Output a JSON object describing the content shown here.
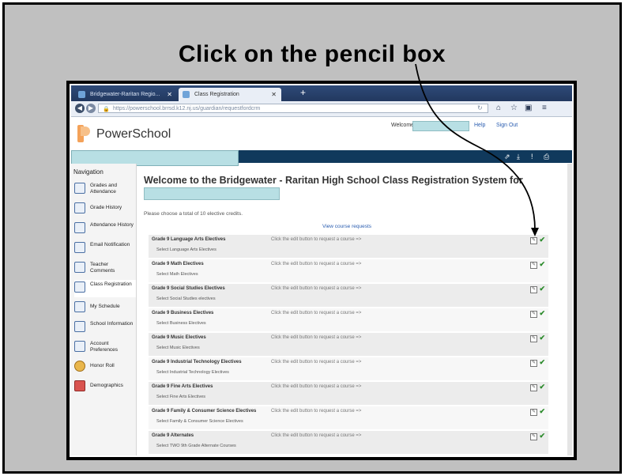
{
  "slide": {
    "title": "Click on the pencil box"
  },
  "browser": {
    "tabs": [
      {
        "label": "Bridgewater-Raritan Regio..."
      },
      {
        "label": "Class Registration"
      }
    ],
    "new_tab_label": "+",
    "url": "https://powerschool.brrsd.k12.nj.us/guardian/requestfordcrm"
  },
  "header": {
    "app_name": "PowerSchool",
    "welcome_label": "Welcome,",
    "help_label": "Help",
    "signout_label": "Sign Out"
  },
  "sidebar": {
    "title": "Navigation",
    "items": [
      {
        "label": "Grades and Attendance",
        "icon": "grades-icon"
      },
      {
        "label": "Grade History",
        "icon": "grade-history-icon"
      },
      {
        "label": "Attendance History",
        "icon": "attendance-icon"
      },
      {
        "label": "Email Notification",
        "icon": "email-icon"
      },
      {
        "label": "Teacher Comments",
        "icon": "comments-icon"
      },
      {
        "label": "Class Registration",
        "icon": "registration-icon"
      },
      {
        "label": "My Schedule",
        "icon": "schedule-icon"
      },
      {
        "label": "School Information",
        "icon": "school-icon"
      },
      {
        "label": "Account Preferences",
        "icon": "account-icon"
      },
      {
        "label": "Honor Roll",
        "icon": "honor-roll-icon"
      },
      {
        "label": "Demographics",
        "icon": "demographics-icon"
      }
    ]
  },
  "main": {
    "title": "Welcome to the Bridgewater - Raritan High School Class Registration System for",
    "instructions": "Please choose a total of 10 elective credits.",
    "view_requests": "View course requests",
    "row_hint": "Click the edit button to request a course =>",
    "courses": [
      {
        "title": "Grade 9 Language Arts Electives",
        "sub": "Select Language Arts Electives"
      },
      {
        "title": "Grade 9 Math Electives",
        "sub": "Select Math Electives"
      },
      {
        "title": "Grade 9 Social Studies Electives",
        "sub": "Select Social Studies electives"
      },
      {
        "title": "Grade 9 Business Electives",
        "sub": "Select Business Electives"
      },
      {
        "title": "Grade 9 Music Electives",
        "sub": "Select Music Electives"
      },
      {
        "title": "Grade 9 Industrial Technology Electives",
        "sub": "Select Industrial Technology Electives"
      },
      {
        "title": "Grade 9 Fine Arts Electives",
        "sub": "Select Fine Arts Electives"
      },
      {
        "title": "Grade 9 Family & Consumer Science Electives",
        "sub": "Select Family & Consumer Science Electives"
      },
      {
        "title": "Grade 9 Alternates",
        "sub": "Select TWO 9th Grade Alternate Courses"
      }
    ]
  },
  "colors": {
    "accent_bar": "#10395c",
    "highlight_box": "#b8dfe4",
    "check": "#2b8a2b"
  }
}
